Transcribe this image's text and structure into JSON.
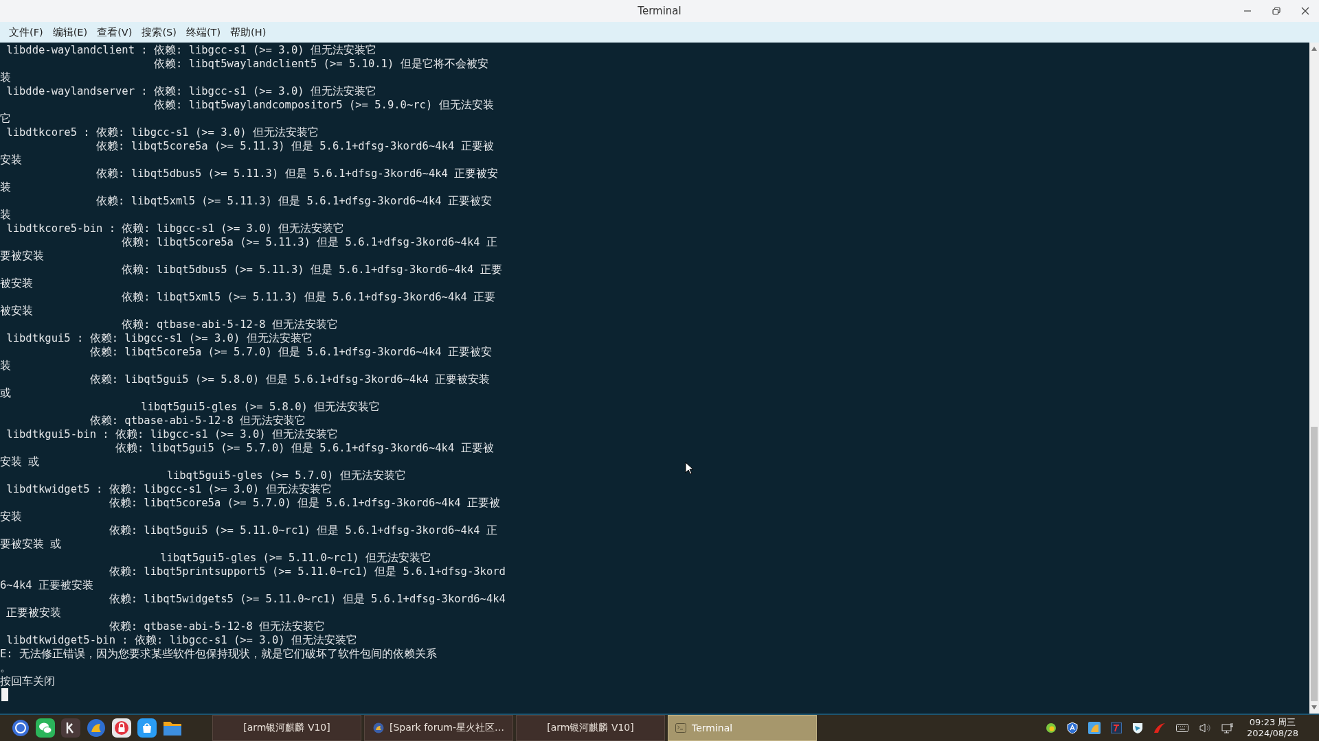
{
  "window": {
    "title": "Terminal"
  },
  "menu": [
    "文件(F)",
    "编辑(E)",
    "查看(V)",
    "搜索(S)",
    "终端(T)",
    "帮助(H)"
  ],
  "terminal": {
    "lines": [
      " libdde-waylandclient : 依赖: libgcc-s1 (>= 3.0) 但无法安装它",
      "                        依赖: libqt5waylandclient5 (>= 5.10.1) 但是它将不会被安",
      "装",
      " libdde-waylandserver : 依赖: libgcc-s1 (>= 3.0) 但无法安装它",
      "                        依赖: libqt5waylandcompositor5 (>= 5.9.0~rc) 但无法安装",
      "它",
      " libdtkcore5 : 依赖: libgcc-s1 (>= 3.0) 但无法安装它",
      "               依赖: libqt5core5a (>= 5.11.3) 但是 5.6.1+dfsg-3kord6~4k4 正要被",
      "安装",
      "               依赖: libqt5dbus5 (>= 5.11.3) 但是 5.6.1+dfsg-3kord6~4k4 正要被安",
      "装",
      "               依赖: libqt5xml5 (>= 5.11.3) 但是 5.6.1+dfsg-3kord6~4k4 正要被安",
      "装",
      " libdtkcore5-bin : 依赖: libgcc-s1 (>= 3.0) 但无法安装它",
      "                   依赖: libqt5core5a (>= 5.11.3) 但是 5.6.1+dfsg-3kord6~4k4 正",
      "要被安装",
      "                   依赖: libqt5dbus5 (>= 5.11.3) 但是 5.6.1+dfsg-3kord6~4k4 正要",
      "被安装",
      "                   依赖: libqt5xml5 (>= 5.11.3) 但是 5.6.1+dfsg-3kord6~4k4 正要",
      "被安装",
      "                   依赖: qtbase-abi-5-12-8 但无法安装它",
      " libdtkgui5 : 依赖: libgcc-s1 (>= 3.0) 但无法安装它",
      "              依赖: libqt5core5a (>= 5.7.0) 但是 5.6.1+dfsg-3kord6~4k4 正要被安",
      "装",
      "              依赖: libqt5gui5 (>= 5.8.0) 但是 5.6.1+dfsg-3kord6~4k4 正要被安装",
      "或",
      "                      libqt5gui5-gles (>= 5.8.0) 但无法安装它",
      "              依赖: qtbase-abi-5-12-8 但无法安装它",
      " libdtkgui5-bin : 依赖: libgcc-s1 (>= 3.0) 但无法安装它",
      "                  依赖: libqt5gui5 (>= 5.7.0) 但是 5.6.1+dfsg-3kord6~4k4 正要被",
      "安装 或",
      "                          libqt5gui5-gles (>= 5.7.0) 但无法安装它",
      " libdtkwidget5 : 依赖: libgcc-s1 (>= 3.0) 但无法安装它",
      "                 依赖: libqt5core5a (>= 5.7.0) 但是 5.6.1+dfsg-3kord6~4k4 正要被",
      "安装",
      "                 依赖: libqt5gui5 (>= 5.11.0~rc1) 但是 5.6.1+dfsg-3kord6~4k4 正",
      "要被安装 或",
      "                         libqt5gui5-gles (>= 5.11.0~rc1) 但无法安装它",
      "                 依赖: libqt5printsupport5 (>= 5.11.0~rc1) 但是 5.6.1+dfsg-3kord",
      "6~4k4 正要被安装",
      "                 依赖: libqt5widgets5 (>= 5.11.0~rc1) 但是 5.6.1+dfsg-3kord6~4k4",
      " 正要被安装",
      "                 依赖: qtbase-abi-5-12-8 但无法安装它",
      " libdtkwidget5-bin : 依赖: libgcc-s1 (>= 3.0) 但无法安装它",
      "E: 无法修正错误，因为您要求某些软件包保持现状，就是它们破坏了软件包间的依赖关系",
      "。",
      "按回车关闭"
    ]
  },
  "taskbar": {
    "tasks": [
      {
        "label": "[arm银河麒麟 V10]",
        "kind": "plain",
        "selected": false
      },
      {
        "label": "[Spark forum-星火社区…",
        "kind": "browser",
        "selected": false
      },
      {
        "label": "[arm银河麒麟 V10]",
        "kind": "plain",
        "selected": false
      },
      {
        "label": "Terminal",
        "kind": "terminal",
        "selected": true
      }
    ],
    "clock": {
      "time": "09:23 周三",
      "date": "2024/08/28"
    }
  }
}
